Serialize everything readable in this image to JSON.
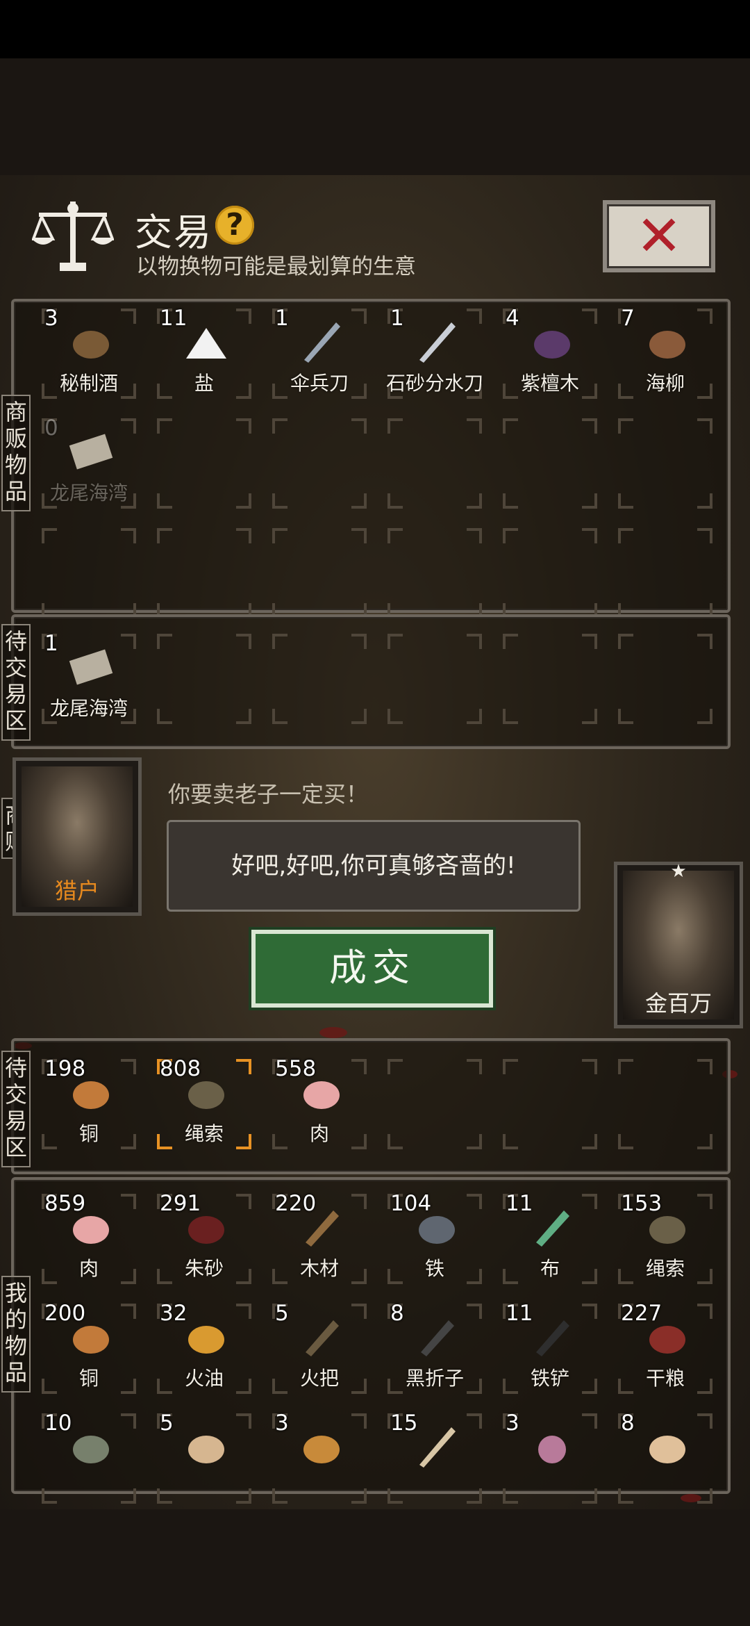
{
  "header": {
    "title": "交易",
    "help_glyph": "?",
    "subtitle": "以物换物可能是最划算的生意",
    "close_glyph": "✕"
  },
  "labels": {
    "merchant_goods": "商贩物品",
    "merchant_pending": "待交易区",
    "merchant_portrait": "商贩",
    "my_pending": "待交易区",
    "my_goods": "我的物品"
  },
  "merchant_goods": [
    {
      "count": "3",
      "name": "秘制酒",
      "icon": "wine-jar-icon"
    },
    {
      "count": "11",
      "name": "盐",
      "icon": "salt-pile-icon"
    },
    {
      "count": "1",
      "name": "伞兵刀",
      "icon": "throwing-knife-icon"
    },
    {
      "count": "1",
      "name": "石砂分水刀",
      "icon": "knife-icon"
    },
    {
      "count": "4",
      "name": "紫檀木",
      "icon": "rosewood-icon"
    },
    {
      "count": "7",
      "name": "海柳",
      "icon": "sea-willow-icon"
    },
    {
      "count": "0",
      "name": "龙尾海湾",
      "icon": "map-icon"
    }
  ],
  "merchant_pending": [
    {
      "count": "1",
      "name": "龙尾海湾",
      "icon": "map-icon"
    }
  ],
  "merchant": {
    "name": "猎户",
    "line": "你要卖老子一定买！",
    "reply": "好吧,好吧,你可真够吝啬的!"
  },
  "player": {
    "name": "金百万",
    "rank": "★"
  },
  "deal_button": "成交",
  "my_pending": [
    {
      "count": "198",
      "name": "铜",
      "icon": "copper-ore-icon"
    },
    {
      "count": "808",
      "name": "绳索",
      "icon": "rope-icon"
    },
    {
      "count": "558",
      "name": "肉",
      "icon": "meat-icon"
    }
  ],
  "my_goods": [
    {
      "count": "859",
      "name": "肉",
      "icon": "meat-icon"
    },
    {
      "count": "291",
      "name": "朱砂",
      "icon": "cinnabar-icon"
    },
    {
      "count": "220",
      "name": "木材",
      "icon": "wood-plank-icon"
    },
    {
      "count": "104",
      "name": "铁",
      "icon": "iron-ore-icon"
    },
    {
      "count": "11",
      "name": "布",
      "icon": "cloth-icon"
    },
    {
      "count": "153",
      "name": "绳索",
      "icon": "rope-icon"
    },
    {
      "count": "200",
      "name": "铜",
      "icon": "copper-ore-icon"
    },
    {
      "count": "32",
      "name": "火油",
      "icon": "oil-flask-icon"
    },
    {
      "count": "5",
      "name": "火把",
      "icon": "torch-icon"
    },
    {
      "count": "8",
      "name": "黑折子",
      "icon": "pickaxe-icon"
    },
    {
      "count": "11",
      "name": "铁铲",
      "icon": "shovel-icon"
    },
    {
      "count": "227",
      "name": "干粮",
      "icon": "dry-rations-icon"
    },
    {
      "count": "10",
      "name": "",
      "icon": "gourd-icon"
    },
    {
      "count": "5",
      "name": "",
      "icon": "claw-icon"
    },
    {
      "count": "3",
      "name": "",
      "icon": "tiger-pelt-icon"
    },
    {
      "count": "15",
      "name": "",
      "icon": "tooth-icon"
    },
    {
      "count": "3",
      "name": "",
      "icon": "pearl-icon"
    },
    {
      "count": "8",
      "name": "",
      "icon": "bone-claw-icon"
    }
  ]
}
